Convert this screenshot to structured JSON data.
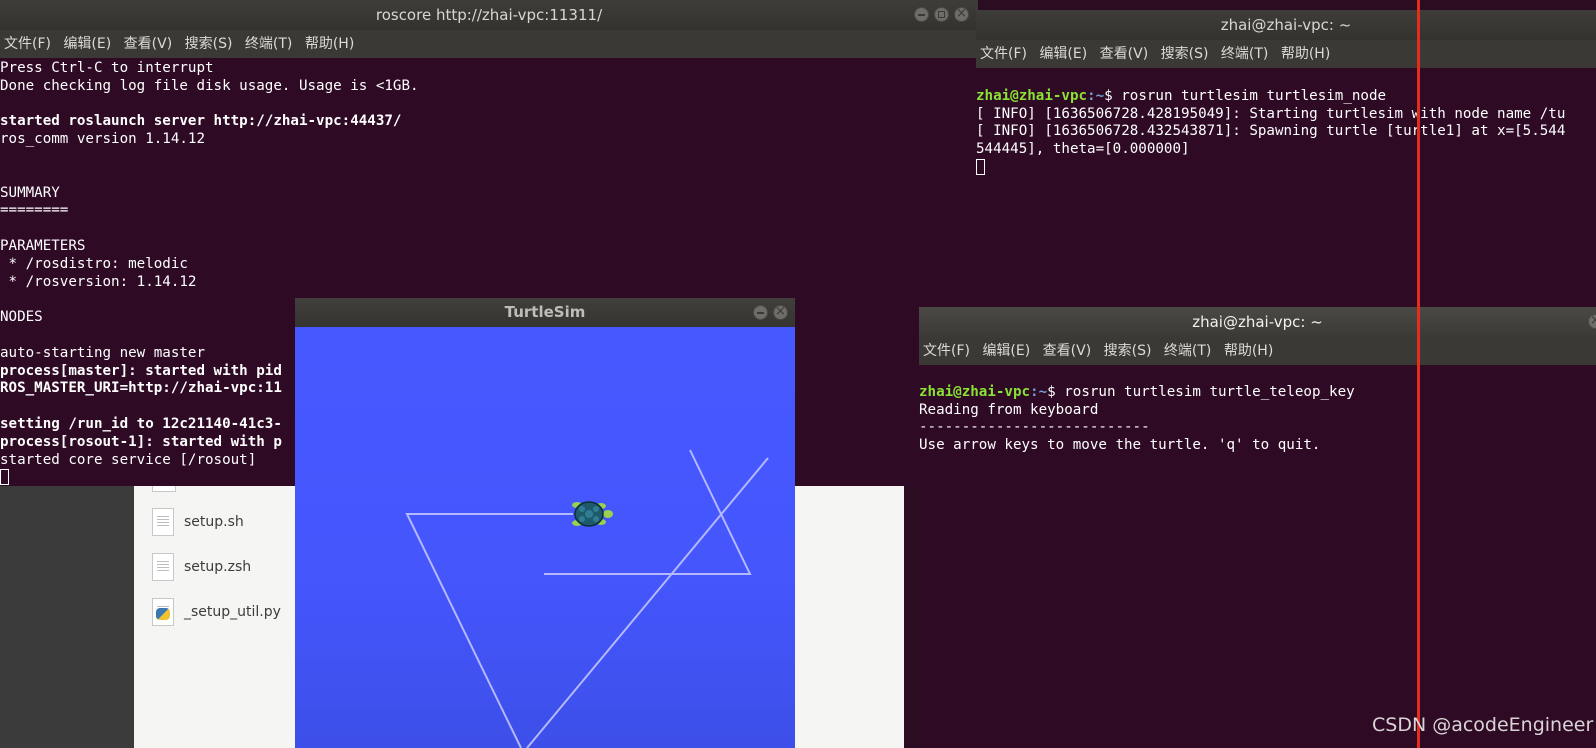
{
  "roscore_window": {
    "title": "roscore http://zhai-vpc:11311/",
    "menu": [
      "文件(F)",
      "编辑(E)",
      "查看(V)",
      "搜索(S)",
      "终端(T)",
      "帮助(H)"
    ],
    "lines": [
      {
        "text": "Press Ctrl-C to interrupt",
        "bold": false
      },
      {
        "text": "Done checking log file disk usage. Usage is <1GB.",
        "bold": false
      },
      {
        "text": "",
        "bold": false
      },
      {
        "text": "started roslaunch server http://zhai-vpc:44437/",
        "bold": true
      },
      {
        "text": "ros_comm version 1.14.12",
        "bold": false
      },
      {
        "text": "",
        "bold": false
      },
      {
        "text": "",
        "bold": false
      },
      {
        "text": "SUMMARY",
        "bold": false
      },
      {
        "text": "========",
        "bold": false
      },
      {
        "text": "",
        "bold": false
      },
      {
        "text": "PARAMETERS",
        "bold": false
      },
      {
        "text": " * /rosdistro: melodic",
        "bold": false
      },
      {
        "text": " * /rosversion: 1.14.12",
        "bold": false
      },
      {
        "text": "",
        "bold": false
      },
      {
        "text": "NODES",
        "bold": false
      },
      {
        "text": "",
        "bold": false
      },
      {
        "text": "auto-starting new master",
        "bold": false
      },
      {
        "text": "process[master]: started with pid",
        "bold": true
      },
      {
        "text": "ROS_MASTER_URI=http://zhai-vpc:11",
        "bold": true
      },
      {
        "text": "",
        "bold": false
      },
      {
        "text": "setting /run_id to 12c21140-41c3-",
        "bold": true
      },
      {
        "text": "process[rosout-1]: started with p",
        "bold": true
      },
      {
        "text": "started core service [/rosout]",
        "bold": false
      }
    ]
  },
  "node_terminal": {
    "title": "zhai@zhai-vpc: ~",
    "menu": [
      "文件(F)",
      "编辑(E)",
      "查看(V)",
      "搜索(S)",
      "终端(T)",
      "帮助(H)"
    ],
    "prompt_user": "zhai@zhai-vpc",
    "prompt_path": ":~",
    "prompt_symbol": "$ ",
    "command": "rosrun turtlesim turtlesim_node",
    "output": [
      "[ INFO] [1636506728.428195049]: Starting turtlesim with node name /tu",
      "[ INFO] [1636506728.432543871]: Spawning turtle [turtle1] at x=[5.544",
      "544445], theta=[0.000000]"
    ]
  },
  "teleop_terminal": {
    "title": "zhai@zhai-vpc: ~",
    "menu": [
      "文件(F)",
      "编辑(E)",
      "查看(V)",
      "搜索(S)",
      "终端(T)",
      "帮助(H)"
    ],
    "prompt_user": "zhai@zhai-vpc",
    "prompt_path": ":~",
    "prompt_symbol": "$ ",
    "command": "rosrun turtlesim turtle_teleop_key",
    "output": [
      "Reading from keyboard",
      "---------------------------",
      "Use arrow keys to move the turtle. 'q' to quit."
    ]
  },
  "turtlesim_window": {
    "title": "TurtleSim",
    "background_color": "#4556ff",
    "trail_color": "#b3b8ff"
  },
  "file_manager": {
    "files": [
      {
        "name": "setup.sh",
        "icon": "shell-script-icon"
      },
      {
        "name": "setup.zsh",
        "icon": "shell-script-icon"
      },
      {
        "name": "_setup_util.py",
        "icon": "python-file-icon"
      }
    ]
  },
  "watermark": "CSDN @acodeEngineer",
  "colors": {
    "terminal_bg": "#2e0a24",
    "prompt_green": "#8ae234",
    "prompt_blue": "#729fcf",
    "red_line": "#e52d1e"
  }
}
